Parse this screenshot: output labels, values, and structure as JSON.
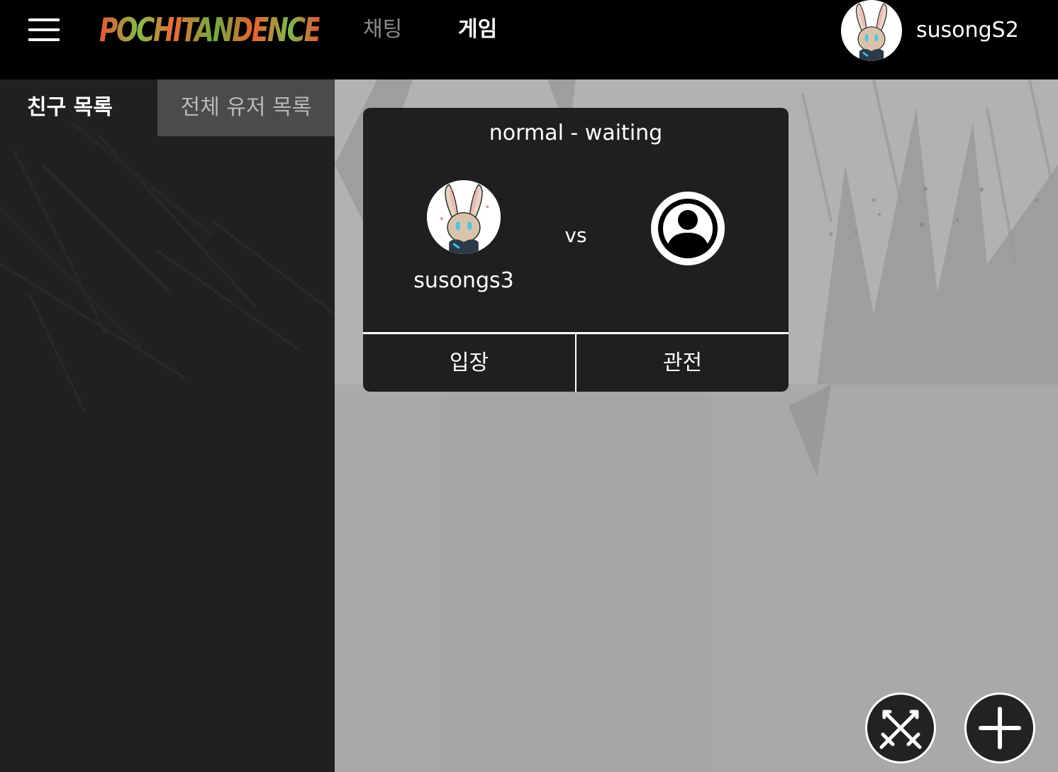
{
  "header": {
    "logo_text": "POCHITANDENCE",
    "nav": [
      {
        "label": "채팅",
        "active": false
      },
      {
        "label": "게임",
        "active": true
      }
    ],
    "user": {
      "name": "susongS2"
    }
  },
  "sidebar": {
    "tabs": [
      {
        "label": "친구 목록",
        "active": true
      },
      {
        "label": "전체 유저 목록",
        "active": false
      }
    ]
  },
  "rooms": [
    {
      "title": "normal - waiting",
      "player1": {
        "name": "susongs3"
      },
      "vs_label": "vs",
      "player2": {
        "name": ""
      },
      "buttons": {
        "enter": "입장",
        "spectate": "관전"
      }
    }
  ],
  "icons": {
    "menu": "hamburger-menu-icon",
    "user_avatar": "bunny-avatar",
    "empty_player": "user-circle-icon",
    "match": "crossed-swords-icon",
    "create": "plus-icon"
  },
  "colors": {
    "header_bg": "#000000",
    "sidebar_bg": "#202020",
    "card_bg": "#1f1f1f",
    "inactive_tab_bg": "#4b4b4b"
  }
}
